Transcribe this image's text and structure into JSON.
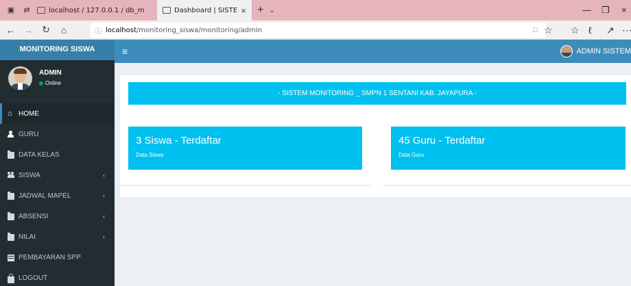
{
  "browser": {
    "tabs": [
      {
        "title": "localhost / 127.0.0.1 / db_m",
        "active": false
      },
      {
        "title": "Dashboard | SISTEM MC",
        "active": true
      }
    ],
    "url_host": "localhost",
    "url_path": "/monitoring_siswa/monitoring/admin"
  },
  "app": {
    "logo": "MONITORING SISWA",
    "header_user": "ADMIN SISTEM"
  },
  "userpanel": {
    "name": "ADMIN",
    "status": "Online",
    "status_color": "#00a65a"
  },
  "menu": [
    {
      "label": "HOME",
      "icon": "home-icon",
      "active": true,
      "expandable": false
    },
    {
      "label": "GURU",
      "icon": "user-icon",
      "active": false,
      "expandable": false
    },
    {
      "label": "DATA KELAS",
      "icon": "folder-icon",
      "active": false,
      "expandable": false
    },
    {
      "label": "SISWA",
      "icon": "users-icon",
      "active": false,
      "expandable": true
    },
    {
      "label": "JADWAL MAPEL",
      "icon": "folder-icon",
      "active": false,
      "expandable": true
    },
    {
      "label": "ABSENSI",
      "icon": "folder-icon",
      "active": false,
      "expandable": true
    },
    {
      "label": "NILAI",
      "icon": "folder-icon",
      "active": false,
      "expandable": true
    },
    {
      "label": "PEMBAYARAN SPP",
      "icon": "card-icon",
      "active": false,
      "expandable": false
    },
    {
      "label": "LOGOUT",
      "icon": "lock-icon",
      "active": false,
      "expandable": false
    }
  ],
  "main": {
    "banner": "- SISTEM MONITORING _ SMPN 1 SENTANI KAB. JAYAPURA -",
    "boxes": [
      {
        "title": "3 Siswa - Terdaftar",
        "subtitle": "Data Siswa"
      },
      {
        "title": "45 Guru - Terdaftar",
        "subtitle": "Data Guru"
      }
    ]
  },
  "colors": {
    "header": "#3c8dbc",
    "logo_bg": "#367fa9",
    "sidebar": "#222d32",
    "info": "#00c0ef",
    "page_bg": "#ecf0f5"
  }
}
